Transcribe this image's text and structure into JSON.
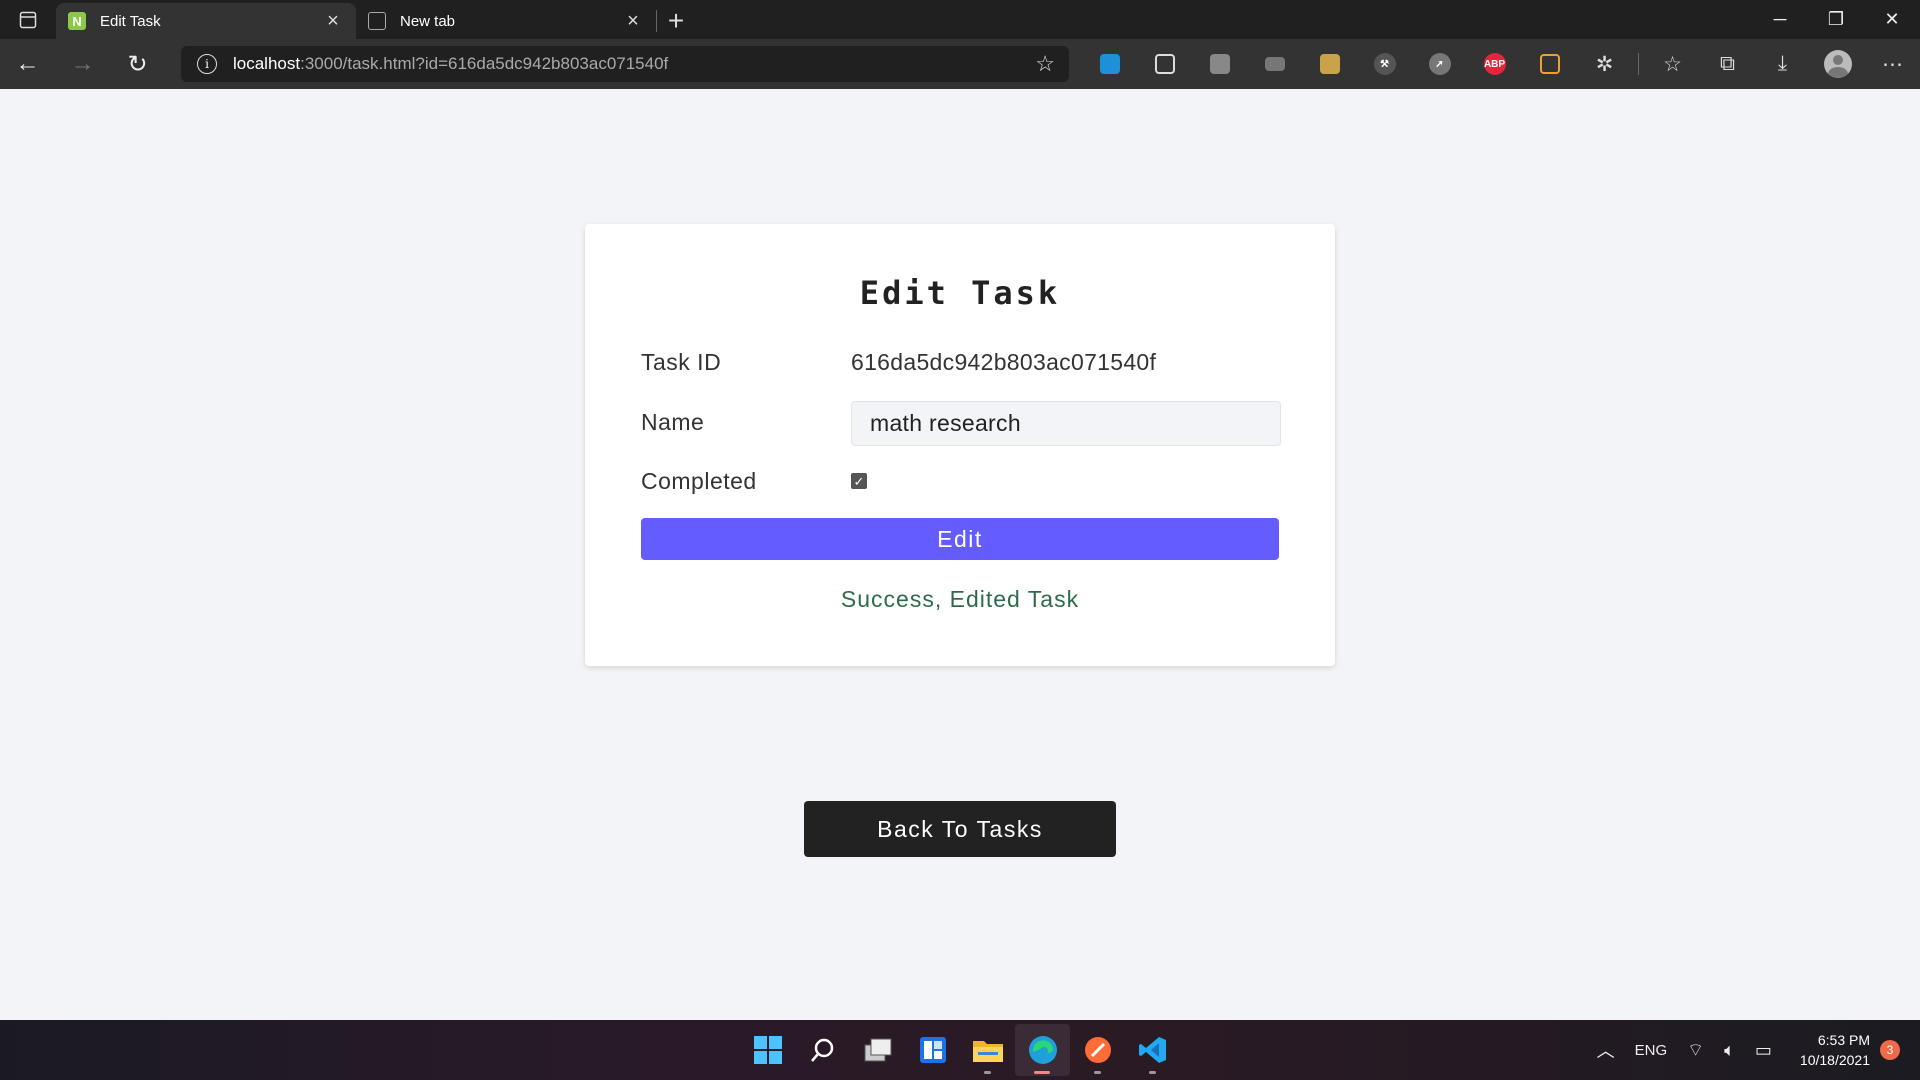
{
  "browser": {
    "tabs": [
      {
        "title": "Edit Task",
        "favicon": "N",
        "active": true
      },
      {
        "title": "New tab",
        "favicon": "",
        "active": false
      }
    ],
    "url": {
      "host": "localhost",
      "rest": ":3000/task.html?id=616da5dc942b803ac071540f"
    },
    "extensions": [
      "share-icon",
      "window-icon",
      "docs-icon",
      "cast-icon",
      "gift-icon",
      "tool-icon",
      "compass-icon",
      "adblock-icon",
      "screenshot-icon",
      "puzzle-icon"
    ],
    "adblock_label": "ABP"
  },
  "page": {
    "title": "Edit Task",
    "fields": {
      "task_id_label": "Task ID",
      "task_id_value": "616da5dc942b803ac071540f",
      "name_label": "Name",
      "name_value": "math research",
      "completed_label": "Completed",
      "completed_checked": true
    },
    "edit_button": "Edit",
    "status_message": "Success, Edited Task",
    "back_button": "Back To Tasks",
    "colors": {
      "accent": "#645cff",
      "success": "#2f6b4a",
      "dark": "#222222",
      "background": "#f3f4f7"
    }
  },
  "taskbar": {
    "apps": [
      "start-icon",
      "search-icon",
      "task-view-icon",
      "widgets-icon",
      "file-explorer-icon",
      "edge-icon",
      "postman-icon",
      "vscode-icon"
    ],
    "language": "ENG",
    "time": "6:53 PM",
    "date": "10/18/2021",
    "notification_count": "3"
  }
}
